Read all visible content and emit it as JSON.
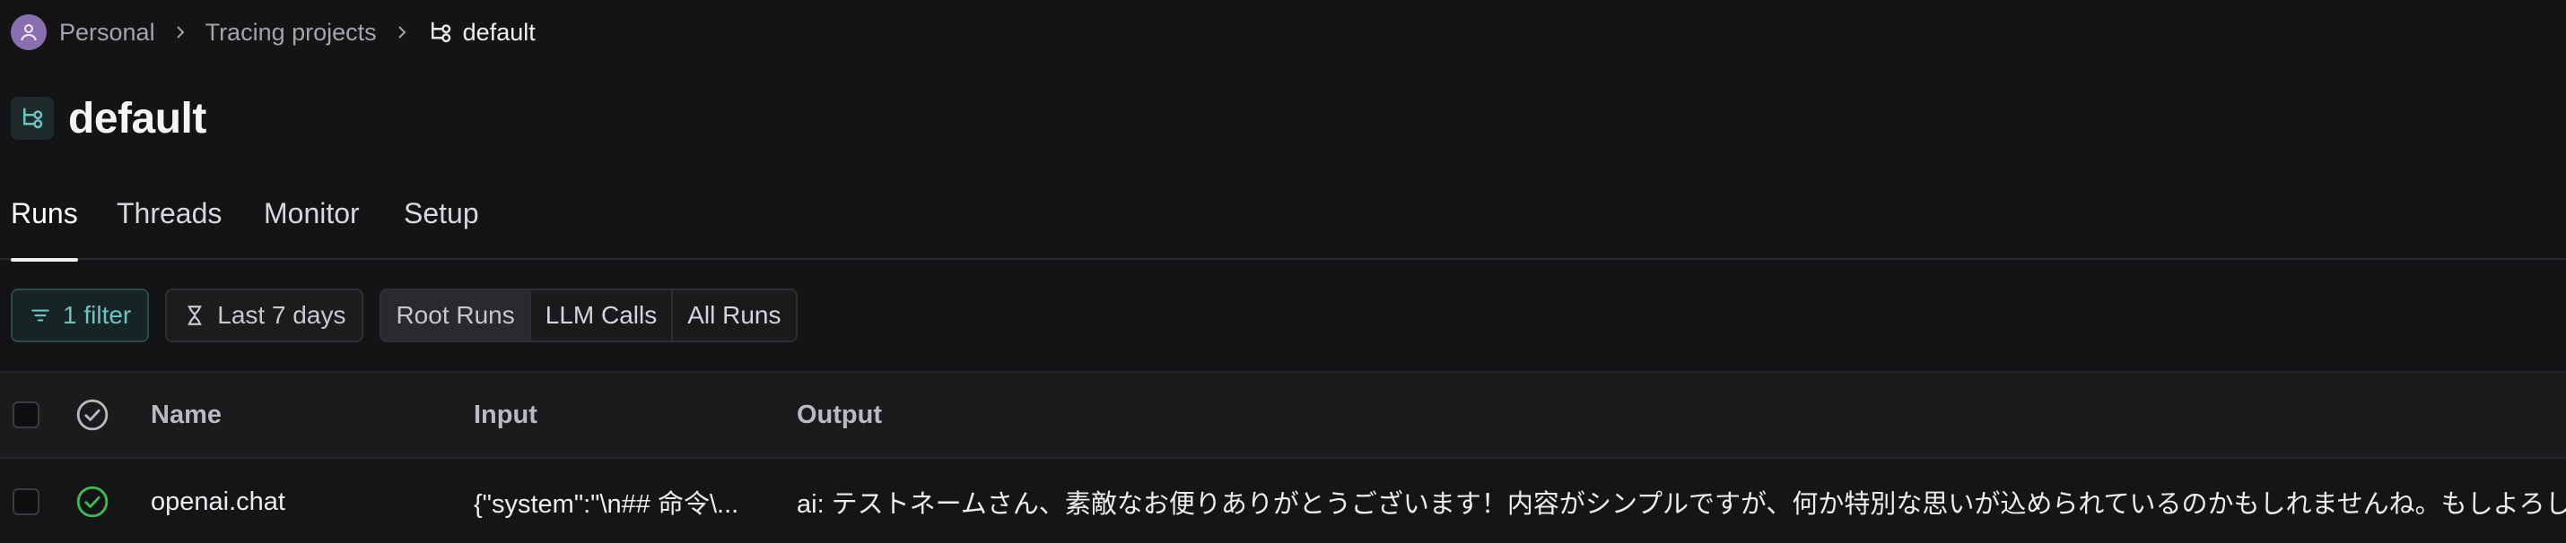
{
  "breadcrumb": {
    "items": [
      "Personal",
      "Tracing projects"
    ],
    "current": "default"
  },
  "page": {
    "title": "default"
  },
  "tabs": [
    {
      "label": "Runs",
      "active": true
    },
    {
      "label": "Threads",
      "active": false
    },
    {
      "label": "Monitor",
      "active": false
    },
    {
      "label": "Setup",
      "active": false
    }
  ],
  "toolbar": {
    "filter_label": "1 filter",
    "time_label": "Last 7 days",
    "segments": [
      "Root Runs",
      "LLM Calls",
      "All Runs"
    ],
    "active_segment": "Root Runs"
  },
  "table": {
    "columns": [
      "Name",
      "Input",
      "Output"
    ],
    "rows": [
      {
        "name": "openai.chat",
        "input": "{\"system\":\"\\n## 命令\\...",
        "output": "ai: テストネームさん、素敵なお便りありがとうございます！内容がシンプルですが、何か特別な思いが込められているのかもしれませんね。もしよろしければ",
        "status": "success"
      }
    ]
  },
  "colors": {
    "background": "#141416",
    "accent": "#6cc3c0",
    "success": "#3fb950",
    "avatar": "#8a6fb0"
  },
  "icons": [
    "person-icon",
    "chevron-right-icon",
    "project-icon",
    "filter-icon",
    "hourglass-icon",
    "check-circle-icon"
  ]
}
